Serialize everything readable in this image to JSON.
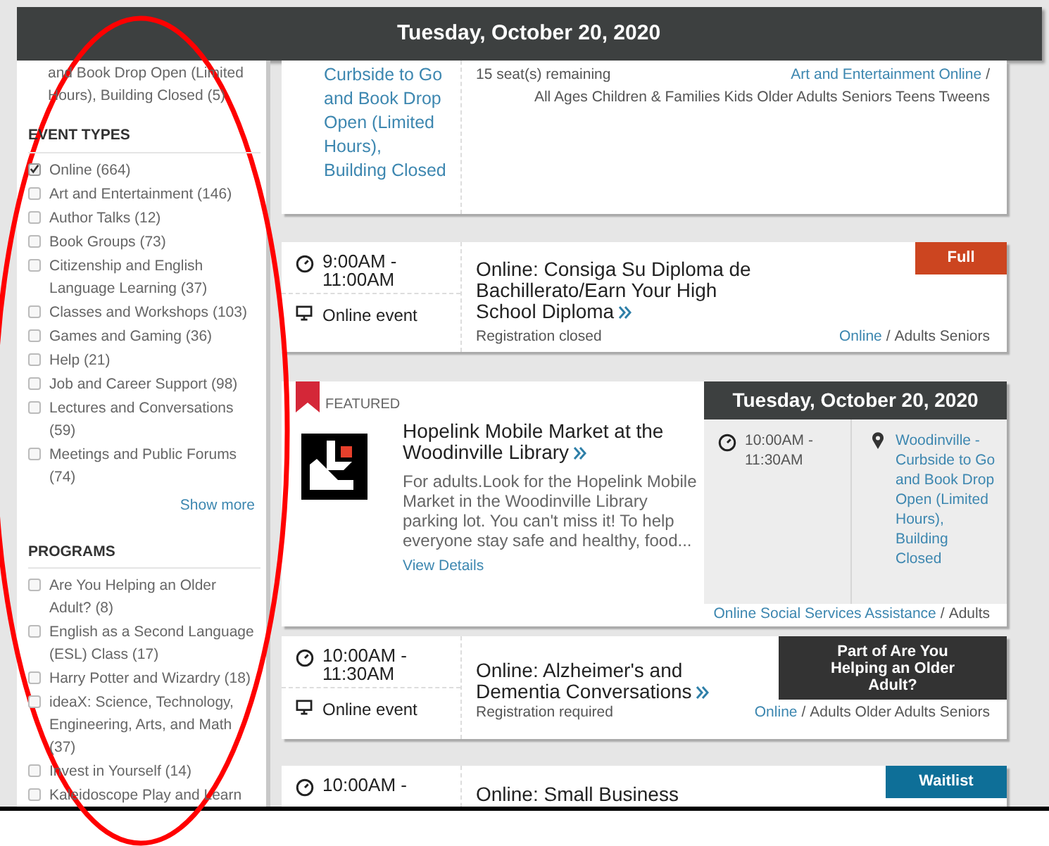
{
  "header": {
    "date": "Tuesday, October 20, 2020"
  },
  "sidebar": {
    "top_fragment": "and Book Drop Open (Limited Hours), Building Closed (5)",
    "sections": [
      {
        "title": "EVENT TYPES",
        "items": [
          {
            "label": "Online (664)",
            "checked": true
          },
          {
            "label": "Art and Entertainment (146)",
            "checked": false
          },
          {
            "label": "Author Talks (12)",
            "checked": false
          },
          {
            "label": "Book Groups (73)",
            "checked": false
          },
          {
            "label": "Citizenship and English Language Learning (37)",
            "checked": false
          },
          {
            "label": "Classes and Workshops (103)",
            "checked": false
          },
          {
            "label": "Games and Gaming (36)",
            "checked": false
          },
          {
            "label": "Help (21)",
            "checked": false
          },
          {
            "label": "Job and Career Support (98)",
            "checked": false
          },
          {
            "label": "Lectures and Conversations (59)",
            "checked": false
          },
          {
            "label": "Meetings and Public Forums (74)",
            "checked": false
          }
        ],
        "show_more": "Show more"
      },
      {
        "title": "PROGRAMS",
        "items": [
          {
            "label": "Are You Helping an Older Adult? (8)",
            "checked": false
          },
          {
            "label": "English as a Second Language (ESL) Class (17)",
            "checked": false
          },
          {
            "label": "Harry Potter and Wizardry (18)",
            "checked": false
          },
          {
            "label": "ideaX: Science, Technology, Engineering, Arts, and Math (37)",
            "checked": false
          },
          {
            "label": "Invest in Yourself (14)",
            "checked": false
          },
          {
            "label": "Kaleidoscope Play and Learn",
            "checked": false
          }
        ]
      }
    ]
  },
  "events": [
    {
      "kind": "partial",
      "location": "Curbside to Go and Book Drop Open (Limited Hours), Building Closed",
      "status": "15 seat(s) remaining",
      "categories": "Art and Entertainment Online",
      "separator": "/",
      "audiences": "All Ages Children & Families Kids Older Adults Seniors Teens Tweens"
    },
    {
      "kind": "regular",
      "time": "9:00AM - 11:00AM",
      "mode": "Online event",
      "title": "Online: Consiga Su Diploma de Bachillerato/Earn Your High School Diploma",
      "status": "Registration closed",
      "badge": {
        "kind": "full",
        "text": "Full"
      },
      "categories": "Online",
      "separator": "/",
      "audiences": "Adults Seniors"
    },
    {
      "kind": "featured",
      "flag": "FEATURED",
      "title": "Hopelink Mobile Market at the Woodinville Library",
      "description": "For adults.Look for the Hopelink Mobile Market in the Woodinville Library parking lot. You can't miss it! To help everyone stay safe and healthy, food...",
      "details_link": "View Details",
      "date": "Tuesday, October 20, 2020",
      "time": "10:00AM - 11:30AM",
      "location": "Woodinville - Curbside to Go and Book Drop Open (Limited Hours), Building Closed",
      "categories": "Online Social Services Assistance",
      "separator": "/",
      "audiences": "Adults"
    },
    {
      "kind": "regular",
      "time": "10:00AM - 11:30AM",
      "mode": "Online event",
      "title": "Online: Alzheimer's and Dementia Conversations",
      "status": "Registration required",
      "badge": {
        "kind": "program",
        "text": "Part of Are You Helping an Older Adult?"
      },
      "categories": "Online",
      "separator": "/",
      "audiences": "Adults Older Adults Seniors"
    },
    {
      "kind": "cut",
      "time": "10:00AM -",
      "title": "Online: Small Business",
      "badge": {
        "kind": "waitlist",
        "text": "Waitlist"
      }
    }
  ]
}
